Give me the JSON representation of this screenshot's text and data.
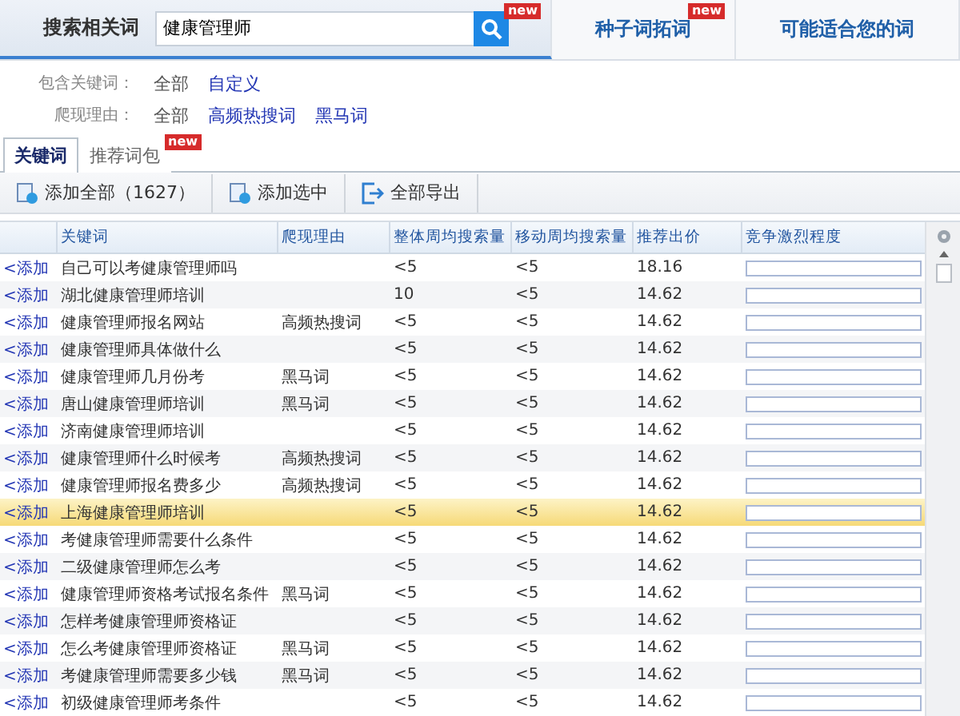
{
  "top_tabs": [
    {
      "label": "搜索相关词",
      "kind": "search",
      "selected": true,
      "badge": "new",
      "query": "健康管理师"
    },
    {
      "label": "种子词拓词",
      "kind": "plain",
      "selected": false,
      "badge": "new"
    },
    {
      "label": "可能适合您的词",
      "kind": "plain",
      "selected": false
    }
  ],
  "filters": [
    {
      "label": "包含关键词：",
      "options": [
        {
          "label": "全部",
          "selected": true
        },
        {
          "label": "自定义",
          "selected": false
        }
      ]
    },
    {
      "label": "爬现理由：",
      "options": [
        {
          "label": "全部",
          "selected": true
        },
        {
          "label": "高频热搜词",
          "selected": false
        },
        {
          "label": "黑马词",
          "selected": false
        }
      ]
    }
  ],
  "tabs": [
    {
      "label": "关键词",
      "selected": true
    },
    {
      "label": "推荐词包",
      "selected": false,
      "badge": "new"
    }
  ],
  "toolbar": [
    {
      "label": "添加全部（1627）",
      "kind": "add"
    },
    {
      "label": "添加选中",
      "kind": "add"
    },
    {
      "label": "全部导出",
      "kind": "export"
    }
  ],
  "table": {
    "columns": [
      "关键词",
      "爬现理由",
      "整体周均搜索量",
      "移动周均搜索量",
      "推荐出价",
      "竞争激烈程度"
    ],
    "rows": [
      {
        "add": "<添加",
        "keyword": "自己可以考健康管理师吗",
        "reason": "",
        "overall": "<5",
        "mobile": "<5",
        "price": "18.16",
        "selected": false
      },
      {
        "add": "<添加",
        "keyword": "湖北健康管理师培训",
        "reason": "",
        "overall": "10",
        "mobile": "<5",
        "price": "14.62",
        "selected": false
      },
      {
        "add": "<添加",
        "keyword": "健康管理师报名网站",
        "reason": "高频热搜词",
        "overall": "<5",
        "mobile": "<5",
        "price": "14.62",
        "selected": false
      },
      {
        "add": "<添加",
        "keyword": "健康管理师具体做什么",
        "reason": "",
        "overall": "<5",
        "mobile": "<5",
        "price": "14.62",
        "selected": false
      },
      {
        "add": "<添加",
        "keyword": "健康管理师几月份考",
        "reason": "黑马词",
        "overall": "<5",
        "mobile": "<5",
        "price": "14.62",
        "selected": false
      },
      {
        "add": "<添加",
        "keyword": "唐山健康管理师培训",
        "reason": "黑马词",
        "overall": "<5",
        "mobile": "<5",
        "price": "14.62",
        "selected": false
      },
      {
        "add": "<添加",
        "keyword": "济南健康管理师培训",
        "reason": "",
        "overall": "<5",
        "mobile": "<5",
        "price": "14.62",
        "selected": false
      },
      {
        "add": "<添加",
        "keyword": "健康管理师什么时候考",
        "reason": "高频热搜词",
        "overall": "<5",
        "mobile": "<5",
        "price": "14.62",
        "selected": false
      },
      {
        "add": "<添加",
        "keyword": "健康管理师报名费多少",
        "reason": "高频热搜词",
        "overall": "<5",
        "mobile": "<5",
        "price": "14.62",
        "selected": false
      },
      {
        "add": "<添加",
        "keyword": "上海健康管理师培训",
        "reason": "",
        "overall": "<5",
        "mobile": "<5",
        "price": "14.62",
        "selected": true
      },
      {
        "add": "<添加",
        "keyword": "考健康管理师需要什么条件",
        "reason": "",
        "overall": "<5",
        "mobile": "<5",
        "price": "14.62",
        "selected": false
      },
      {
        "add": "<添加",
        "keyword": "二级健康管理师怎么考",
        "reason": "",
        "overall": "<5",
        "mobile": "<5",
        "price": "14.62",
        "selected": false
      },
      {
        "add": "<添加",
        "keyword": "健康管理师资格考试报名条件",
        "reason": "黑马词",
        "overall": "<5",
        "mobile": "<5",
        "price": "14.62",
        "selected": false
      },
      {
        "add": "<添加",
        "keyword": "怎样考健康管理师资格证",
        "reason": "",
        "overall": "<5",
        "mobile": "<5",
        "price": "14.62",
        "selected": false
      },
      {
        "add": "<添加",
        "keyword": "怎么考健康管理师资格证",
        "reason": "黑马词",
        "overall": "<5",
        "mobile": "<5",
        "price": "14.62",
        "selected": false
      },
      {
        "add": "<添加",
        "keyword": "考健康管理师需要多少钱",
        "reason": "黑马词",
        "overall": "<5",
        "mobile": "<5",
        "price": "14.62",
        "selected": false
      },
      {
        "add": "<添加",
        "keyword": "初级健康管理师考条件",
        "reason": "",
        "overall": "<5",
        "mobile": "<5",
        "price": "14.62",
        "selected": false
      }
    ]
  }
}
